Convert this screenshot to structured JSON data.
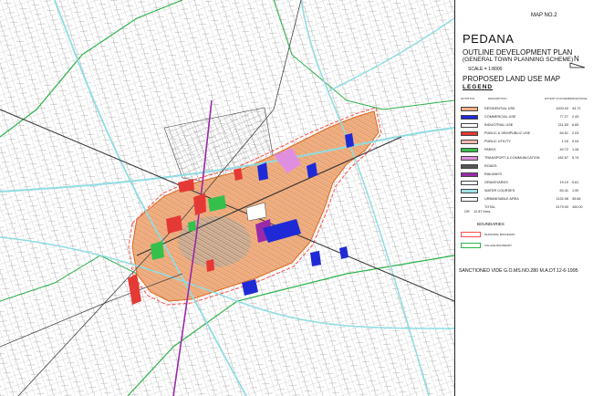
{
  "title": {
    "map_no": "MAP NO.2",
    "town": "PEDANA",
    "plan": "OUTLINE DEVELOPMENT PLAN",
    "scheme": "(GENERAL TOWN PLANNING SCHEME)",
    "scale": "SCALE = 1:8000",
    "north": "N",
    "land_use_map": "PROPOSED LAND USE MAP",
    "legend": "LEGEND"
  },
  "legend_header": {
    "col_notation": "NOTATION",
    "col_description": "DESCRIPTION",
    "col_extent": "EXTENT IN ACRES",
    "col_percent": "PERCENTAGE"
  },
  "legend_rows": [
    {
      "label": "RESIDENTIAL USE",
      "area": "1000.03",
      "pct": "43.72",
      "color": "#f4b183"
    },
    {
      "label": "COMMERCIAL USE",
      "area": "77.27",
      "pct": "2.43",
      "color": "#1f2ad6"
    },
    {
      "label": "INDUSTRIAL USE",
      "area": "211.53",
      "pct": "6.65",
      "color": "#ffffff"
    },
    {
      "label": "PUBLIC & SEMIPUBLIC USE",
      "area": "84.51",
      "pct": "2.03",
      "color": "#e53935"
    },
    {
      "label": "PUBLIC UTILITY",
      "area": "1.16",
      "pct": "0.04",
      "color": "#f7b7b0"
    },
    {
      "label": "PARKS",
      "area": "40.72",
      "pct": "1.28",
      "color": "#34c04a"
    },
    {
      "label": "TRANSPORT & COMMUNICATION",
      "area": "182.57",
      "pct": "5.74",
      "color": "#e08fe0"
    },
    {
      "label": "ROADS",
      "area": "",
      "pct": "",
      "color": "#555555"
    },
    {
      "label": "RAILWAYS",
      "area": "",
      "pct": "",
      "color": "#9a2aa8"
    },
    {
      "label": "GRAVEYARDS",
      "area": "19.19",
      "pct": "0.61",
      "color": "#ffffff"
    },
    {
      "label": "WATER COURSES",
      "area": "60.41",
      "pct": "1.90",
      "color": "#9fe3e6"
    },
    {
      "label": "URBANISABLE AREA",
      "area": "1132.06",
      "pct": "35.66",
      "color": "#ffffff"
    },
    {
      "label": "TOTAL",
      "area": "3179.93",
      "pct": "100.00",
      "color": ""
    }
  ],
  "total_note": {
    "prefix": "OR",
    "value": "12.87 Kms."
  },
  "boundaries": {
    "heading": "BOUNDARIES",
    "municipal": "MUNICIPAL BOUNDARY",
    "village": "VILLAGE BOUNDARY",
    "municipal_color": "#ff4d4d",
    "village_color": "#2bb24a"
  },
  "sanction": "SANCTIONED VIDE G.O.MS.NO.280 M.A.DT.12-6-1995",
  "colors": {
    "residential": "#f4b183",
    "commercial": "#1f2ad6",
    "public": "#e53935",
    "parks": "#34c04a",
    "transport": "#e08fe0",
    "railway": "#9a2aa8",
    "water": "#8fdde2",
    "roads": "#333333"
  }
}
